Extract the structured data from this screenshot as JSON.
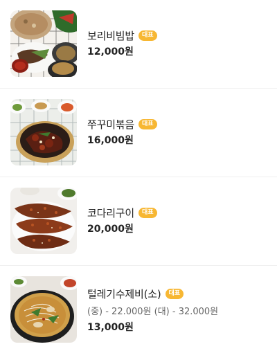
{
  "colors": {
    "badge": "#f7b733",
    "text": "#222222",
    "desc": "#666666",
    "divider": "#f0f0f0"
  },
  "menu": {
    "items": [
      {
        "name": "보리비빔밥",
        "badge": "대표",
        "description": "",
        "price": "12,000원",
        "image": "barley-bibimbap-photo"
      },
      {
        "name": "쭈꾸미볶음",
        "badge": "대표",
        "description": "",
        "price": "16,000원",
        "image": "stir-fried-webfoot-octopus-photo"
      },
      {
        "name": "코다리구이",
        "badge": "대표",
        "description": "",
        "price": "20,000원",
        "image": "grilled-pollock-photo"
      },
      {
        "name": "털레기수제비(소)",
        "badge": "대표",
        "description": "(중) - 22.000원 (대) - 32.000원",
        "price": "13,000원",
        "image": "sujebi-stew-photo"
      }
    ]
  }
}
